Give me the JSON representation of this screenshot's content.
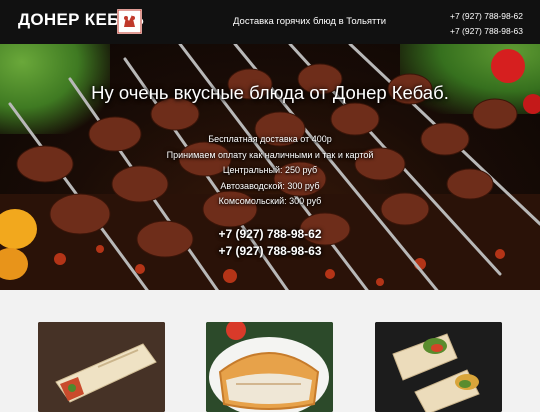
{
  "header": {
    "brand": "ДОНЕР КЕБАБ",
    "tagline": "Доставка горячих блюд в Тольятти",
    "phones": [
      "+7 (927) 788-98-62",
      "+7 (927) 788-98-63"
    ]
  },
  "hero": {
    "title": "Ну очень вкусные блюда от Донер Кебаб.",
    "info": [
      "Бесплатная доставка от 400р",
      "Принимаем оплату как наличными и так и картой",
      "Центральный: 250 руб",
      "Автозаводской: 300 руб",
      "Комсомольский: 300 руб"
    ],
    "phones": [
      "+7 (927) 788-98-62",
      "+7 (927) 788-98-63"
    ]
  },
  "products": [
    {
      "icon": "shawarma-wrap-photo"
    },
    {
      "icon": "pita-sandwich-photo"
    },
    {
      "icon": "sliced-wrap-photo"
    }
  ],
  "colors": {
    "header_bg": "#111111",
    "page_bg": "#f2f2f2",
    "text_light": "#ffffff"
  }
}
